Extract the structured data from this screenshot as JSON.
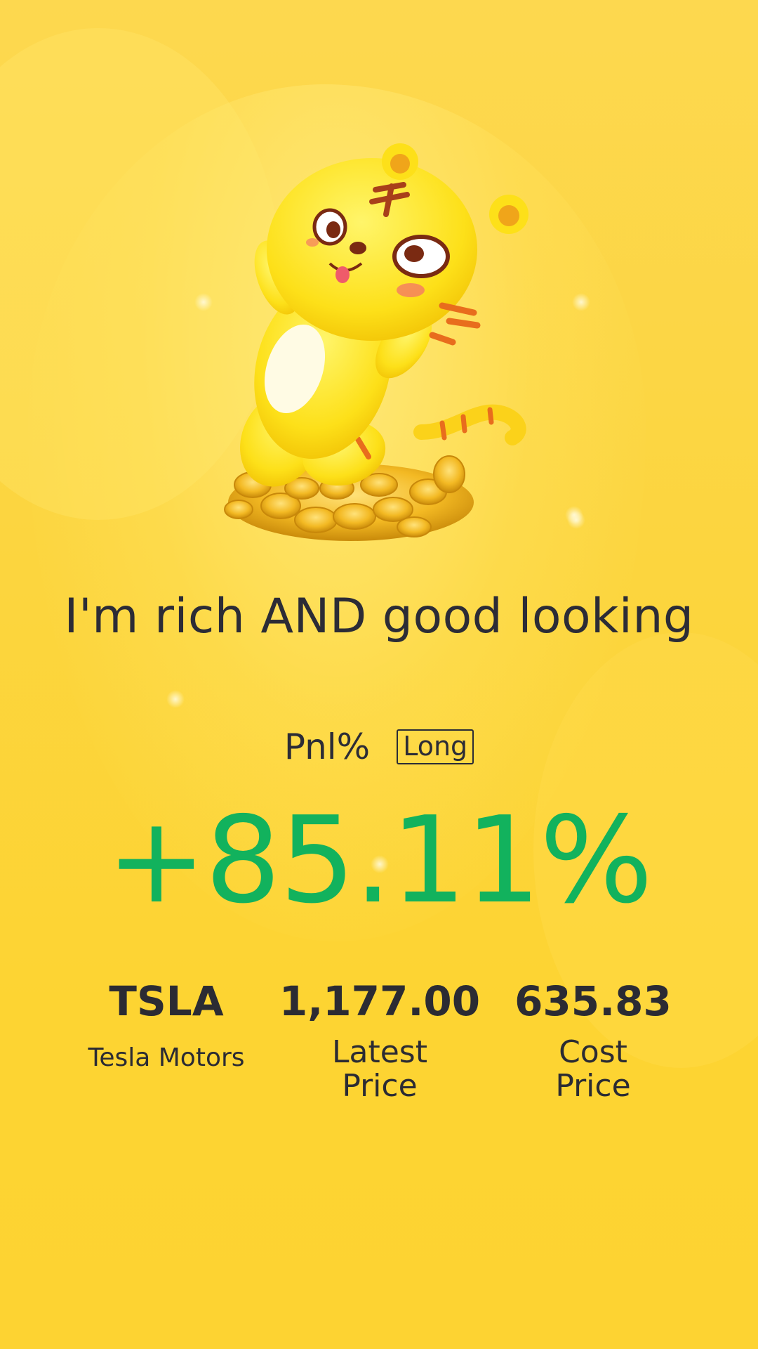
{
  "headline": "I'm rich AND good looking",
  "pnl": {
    "label": "Pnl%",
    "direction": "Long",
    "value": "+85.11%"
  },
  "stats": {
    "symbol": "TSLA",
    "company": "Tesla Motors",
    "latest_price": "1,177.00",
    "latest_label_line1": "Latest",
    "latest_label_line2": "Price",
    "cost_price": "635.83",
    "cost_label_line1": "Cost",
    "cost_label_line2": "Price"
  },
  "colors": {
    "background": "#fdd43a",
    "gain": "#12b25d",
    "text": "#2c2c36"
  },
  "icons": {
    "mascot": "tiger-on-gold-coins-illustration"
  }
}
